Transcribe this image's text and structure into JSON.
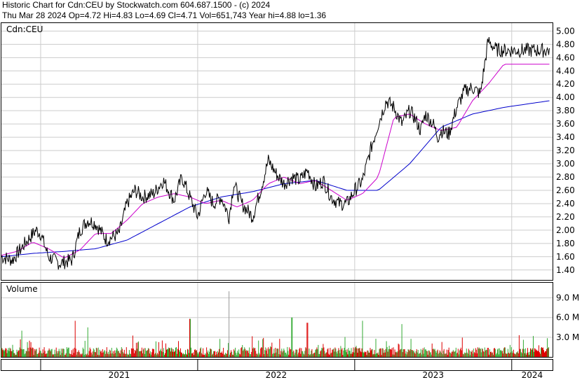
{
  "header": {
    "line1": "Historic Chart for Cdn:CEU by Stockwatch.com 604.687.1500 - (c) 2024",
    "line2": "Thu Mar 28 2024  Op=4.72  Hi=4.83  Lo=4.69  Cl=4.71  Vol=651,743  Year hi=4.88  lo=1.36"
  },
  "price_panel": {
    "label": "Cdn:CEU"
  },
  "volume_panel": {
    "label": "Volume"
  },
  "chart_data": {
    "type": "line",
    "title": "Historic Chart for Cdn:CEU",
    "price_axis": {
      "ylim": [
        1.25,
        5.12
      ],
      "ticks": [
        "1.40",
        "1.60",
        "1.80",
        "2.00",
        "2.20",
        "2.40",
        "2.60",
        "2.80",
        "3.00",
        "3.20",
        "3.40",
        "3.60",
        "3.80",
        "4.00",
        "4.20",
        "4.40",
        "4.60",
        "4.80",
        "5.00"
      ]
    },
    "volume_axis": {
      "ylim": [
        0,
        11.3
      ],
      "unit": "M",
      "ticks": [
        "3.0 M",
        "6.0 M",
        "9.0 M"
      ]
    },
    "x_axis": {
      "ticks": [
        "2021",
        "2022",
        "2023",
        "2024"
      ]
    },
    "grid": true,
    "price_series": {
      "name": "Close",
      "color": "#000000",
      "x": [
        2020.75,
        2020.82,
        2020.9,
        2020.97,
        2021.0,
        2021.05,
        2021.12,
        2021.2,
        2021.25,
        2021.3,
        2021.35,
        2021.42,
        2021.5,
        2021.55,
        2021.6,
        2021.65,
        2021.72,
        2021.78,
        2021.85,
        2021.9,
        2021.95,
        2022.0,
        2022.05,
        2022.1,
        2022.15,
        2022.2,
        2022.23,
        2022.28,
        2022.35,
        2022.4,
        2022.45,
        2022.5,
        2022.55,
        2022.6,
        2022.65,
        2022.7,
        2022.75,
        2022.8,
        2022.85,
        2022.9,
        2022.95,
        2023.0,
        2023.05,
        2023.1,
        2023.15,
        2023.2,
        2023.25,
        2023.3,
        2023.35,
        2023.38,
        2023.42,
        2023.45,
        2023.5,
        2023.53,
        2023.55,
        2023.6,
        2023.65,
        2023.7,
        2023.75,
        2023.8,
        2023.85,
        2023.9,
        2023.95,
        2024.0,
        2024.05,
        2024.1,
        2024.15,
        2024.2,
        2024.24
      ],
      "values": [
        1.6,
        1.55,
        1.8,
        2.0,
        1.95,
        1.6,
        1.5,
        1.55,
        2.0,
        2.15,
        2.1,
        1.85,
        1.95,
        2.4,
        2.6,
        2.5,
        2.55,
        2.75,
        2.45,
        2.8,
        2.5,
        2.2,
        2.6,
        2.4,
        2.5,
        2.2,
        2.7,
        2.4,
        2.2,
        2.6,
        3.05,
        2.85,
        2.7,
        2.8,
        2.75,
        2.9,
        2.65,
        2.75,
        2.5,
        2.4,
        2.4,
        2.6,
        2.75,
        3.2,
        3.6,
        3.95,
        3.85,
        3.6,
        3.8,
        3.7,
        3.5,
        3.75,
        3.6,
        3.4,
        3.5,
        3.45,
        3.85,
        4.1,
        4.15,
        4.05,
        4.85,
        4.72,
        4.71,
        4.71,
        4.71,
        4.71,
        4.71,
        4.71,
        4.71
      ]
    },
    "ma_short": {
      "color": "#cc00cc",
      "x": [
        2020.75,
        2020.85,
        2020.95,
        2021.05,
        2021.15,
        2021.25,
        2021.35,
        2021.45,
        2021.55,
        2021.65,
        2021.75,
        2021.85,
        2021.95,
        2022.05,
        2022.15,
        2022.25,
        2022.35,
        2022.45,
        2022.55,
        2022.65,
        2022.75,
        2022.85,
        2022.95,
        2023.05,
        2023.15,
        2023.25,
        2023.35,
        2023.45,
        2023.55,
        2023.65,
        2023.75,
        2023.85,
        2023.95,
        2024.05,
        2024.15,
        2024.24
      ],
      "values": [
        1.62,
        1.68,
        1.82,
        1.72,
        1.58,
        1.7,
        1.95,
        1.95,
        2.15,
        2.4,
        2.5,
        2.55,
        2.5,
        2.4,
        2.45,
        2.35,
        2.45,
        2.7,
        2.8,
        2.7,
        2.75,
        2.6,
        2.45,
        2.55,
        2.8,
        3.7,
        3.75,
        3.6,
        3.5,
        3.55,
        3.95,
        4.2,
        4.5,
        4.5,
        4.5,
        4.5
      ]
    },
    "ma_long": {
      "color": "#0000cc",
      "x": [
        2020.75,
        2020.95,
        2021.15,
        2021.35,
        2021.55,
        2021.75,
        2021.95,
        2022.15,
        2022.35,
        2022.55,
        2022.75,
        2022.95,
        2023.15,
        2023.35,
        2023.55,
        2023.75,
        2023.95,
        2024.24
      ],
      "values": [
        1.6,
        1.65,
        1.68,
        1.72,
        1.85,
        2.1,
        2.35,
        2.5,
        2.58,
        2.7,
        2.75,
        2.6,
        2.6,
        3.0,
        3.55,
        3.75,
        3.85,
        3.95
      ]
    },
    "volume_series": {
      "name": "Volume",
      "up_color": "#33aa33",
      "down_color": "#dd0000",
      "spike_color": "#999999",
      "peaks": [
        {
          "x": 2021.22,
          "value": 5.5
        },
        {
          "x": 2021.3,
          "value": 4.5
        },
        {
          "x": 2021.95,
          "value": 5.8
        },
        {
          "x": 2022.2,
          "value": 10.0
        },
        {
          "x": 2022.6,
          "value": 6.0
        },
        {
          "x": 2022.7,
          "value": 5.2
        },
        {
          "x": 2023.3,
          "value": 5.0
        },
        {
          "x": 2023.05,
          "value": 5.5
        },
        {
          "x": 2020.88,
          "value": 4.0
        }
      ]
    }
  }
}
